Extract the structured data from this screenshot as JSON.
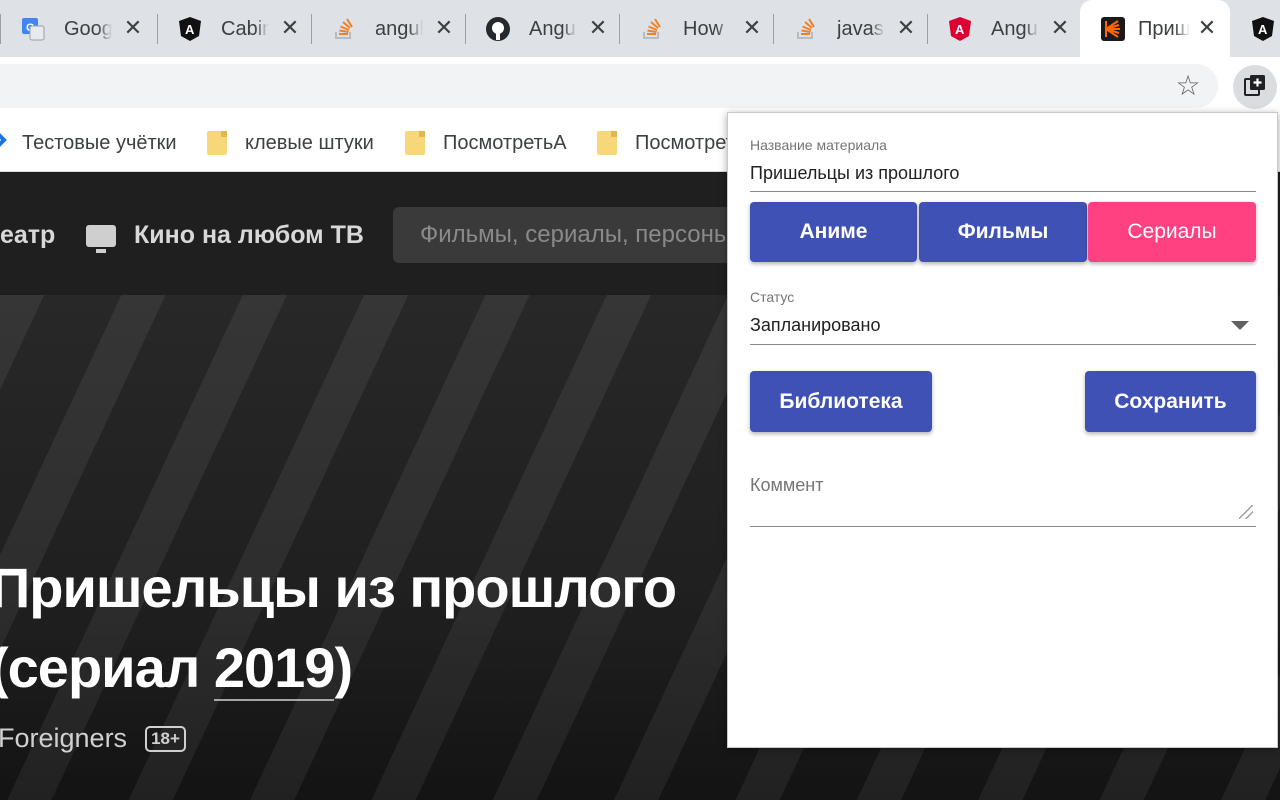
{
  "tabs": [
    {
      "title": "Google",
      "icon": "google-translate-icon"
    },
    {
      "title": "Cabinet",
      "icon": "angular-icon"
    },
    {
      "title": "angular",
      "icon": "stackoverflow-icon"
    },
    {
      "title": "Angular",
      "icon": "github-icon"
    },
    {
      "title": "How",
      "icon": "stackoverflow-icon"
    },
    {
      "title": "javascript",
      "icon": "stackoverflow-icon"
    },
    {
      "title": "Angular",
      "icon": "angular-red-icon"
    },
    {
      "title": "Пришельцы",
      "icon": "kinopoisk-icon",
      "active": true
    },
    {
      "title": "",
      "icon": "angular-icon"
    }
  ],
  "bookmarks": [
    {
      "label": "Тестовые учётки",
      "icon": "bookmark-icon"
    },
    {
      "label": "клевые штуки",
      "icon": "folder-icon"
    },
    {
      "label": "ПосмотретьА",
      "icon": "folder-icon"
    },
    {
      "label": "Посмотреть",
      "icon": "folder-icon"
    }
  ],
  "site": {
    "nav_teatr": "еатр",
    "nav_tv": "Кино на любом ТВ",
    "search_placeholder": "Фильмы, сериалы, персоны",
    "title_line1": "Пришельцы из прошлого",
    "title_line2_prefix": "(сериал ",
    "title_year": "2019",
    "title_line2_suffix": ")",
    "original_title": "Foreigners",
    "age_rating": "18+"
  },
  "popup": {
    "material_label": "Название материала",
    "material_value": "Пришельцы из прошлого",
    "type_buttons": [
      {
        "label": "Аниме",
        "selected": false
      },
      {
        "label": "Фильмы",
        "selected": false
      },
      {
        "label": "Сериалы",
        "selected": true
      }
    ],
    "status_label": "Статус",
    "status_value": "Запланировано",
    "library_button": "Библиотека",
    "save_button": "Сохранить",
    "comment_placeholder": "Коммент"
  },
  "colors": {
    "primary": "#3f51b5",
    "accent": "#ff4081"
  }
}
